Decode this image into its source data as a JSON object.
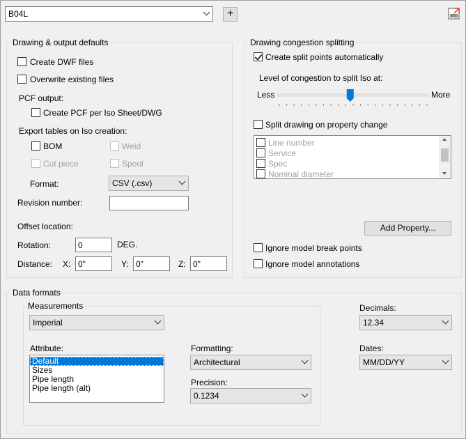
{
  "top": {
    "selected_spec": "B04L",
    "add_label": "+"
  },
  "drawing_output": {
    "title": "Drawing & output defaults",
    "create_dwf": {
      "label": "Create DWF files",
      "checked": false
    },
    "overwrite": {
      "label": "Overwrite existing files",
      "checked": false
    },
    "pcf_output_label": "PCF output:",
    "create_pcf": {
      "label": "Create PCF per Iso Sheet/DWG",
      "checked": false
    },
    "export_tables_label": "Export tables on Iso creation:",
    "bom": {
      "label": "BOM",
      "checked": false
    },
    "weld": {
      "label": "Weld",
      "checked": false,
      "enabled": false
    },
    "cut_piece": {
      "label": "Cut piece",
      "checked": false,
      "enabled": false
    },
    "spool": {
      "label": "Spool",
      "checked": false,
      "enabled": false
    },
    "format_label": "Format:",
    "format_value": "CSV (.csv)",
    "revision_label": "Revision number:",
    "revision_value": "",
    "offset_label": "Offset location:",
    "rotation_label": "Rotation:",
    "rotation_value": "0",
    "rotation_unit": "DEG.",
    "distance_label": "Distance:",
    "x_label": "X:",
    "x_value": "0\"",
    "y_label": "Y:",
    "y_value": "0\"",
    "z_label": "Z:",
    "z_value": "0\""
  },
  "congestion": {
    "title": "Drawing congestion splitting",
    "create_split": {
      "label": "Create split points automatically",
      "checked": true
    },
    "level_label": "Level of congestion to split Iso at:",
    "less_label": "Less",
    "more_label": "More",
    "slider_level": 0.48,
    "split_property": {
      "label": "Split drawing on property change",
      "checked": false
    },
    "properties": [
      {
        "label": "Line number",
        "checked": false
      },
      {
        "label": "Service",
        "checked": false
      },
      {
        "label": "Spec",
        "checked": false
      },
      {
        "label": "Nominal diameter",
        "checked": false
      }
    ],
    "add_property_label": "Add Property...",
    "ignore_break": {
      "label": "Ignore model break points",
      "checked": false
    },
    "ignore_annotations": {
      "label": "Ignore model annotations",
      "checked": false
    }
  },
  "data_formats": {
    "title": "Data formats",
    "measurements_title": "Measurements",
    "measurements_value": "Imperial",
    "attribute_label": "Attribute:",
    "attributes": [
      "Default",
      "Sizes",
      "Pipe length",
      "Pipe length (alt)"
    ],
    "selected_attribute": "Default",
    "formatting_label": "Formatting:",
    "formatting_value": "Architectural",
    "precision_label": "Precision:",
    "precision_value": "0.1234",
    "decimals_label": "Decimals:",
    "decimals_value": "12.34",
    "dates_label": "Dates:",
    "dates_value": "MM/DD/YY"
  },
  "colors": {
    "window_bg": "#f0f0f0",
    "selection": "#0078d7",
    "slider_thumb": "#0078d7"
  }
}
